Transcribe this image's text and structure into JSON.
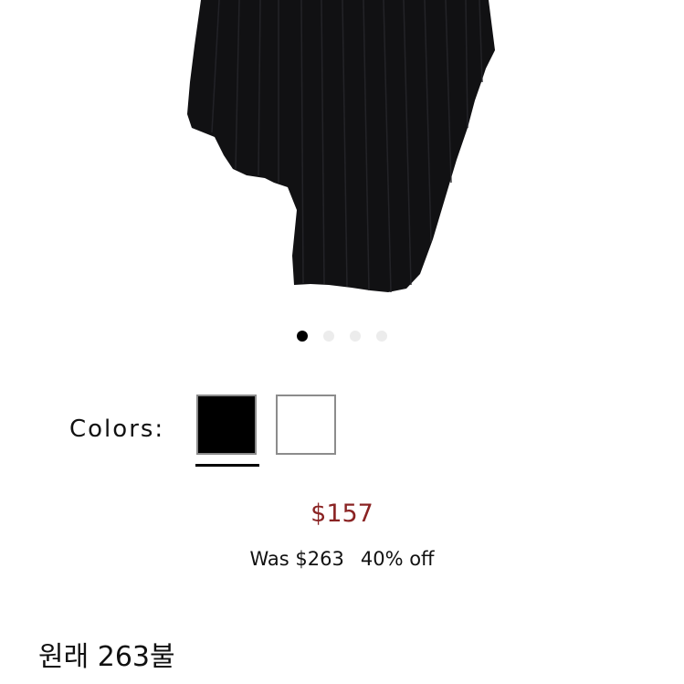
{
  "product": {
    "image_label": "black pleated asymmetric skirt",
    "carousel": {
      "dot_count": 4,
      "active_index": 0
    }
  },
  "colors": {
    "label": "Colors:",
    "options": [
      {
        "name": "black",
        "hex": "#000000",
        "selected": true
      },
      {
        "name": "white",
        "hex": "#ffffff",
        "selected": false
      }
    ]
  },
  "pricing": {
    "current_price": "$157",
    "was_price": "Was $263",
    "discount": "40% off",
    "price_color": "#8a2323"
  },
  "caption": {
    "text": "원래 263불"
  }
}
